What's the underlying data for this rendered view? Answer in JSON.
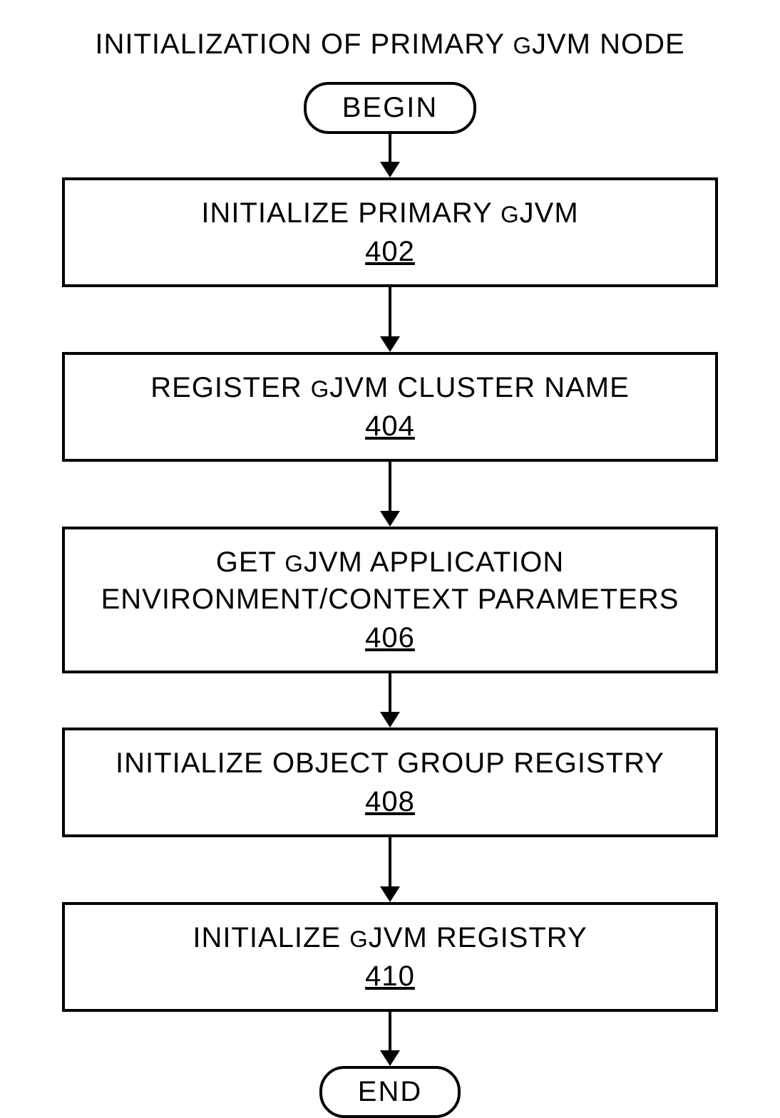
{
  "title_pre": "INITIALIZATION OF PRIMARY ",
  "title_g": "G",
  "title_post": "JVM NODE",
  "begin": "BEGIN",
  "end": "END",
  "steps": [
    {
      "text_pre": "INITIALIZE PRIMARY ",
      "text_g": "G",
      "text_post": "JVM",
      "line2": "",
      "ref": "402"
    },
    {
      "text_pre": "REGISTER ",
      "text_g": "G",
      "text_post": "JVM CLUSTER NAME",
      "line2": "",
      "ref": "404"
    },
    {
      "text_pre": "GET ",
      "text_g": "G",
      "text_post": "JVM APPLICATION",
      "line2": "ENVIRONMENT/CONTEXT PARAMETERS",
      "ref": "406"
    },
    {
      "text_pre": "INITIALIZE OBJECT GROUP REGISTRY",
      "text_g": "",
      "text_post": "",
      "line2": "",
      "ref": "408"
    },
    {
      "text_pre": "INITIALIZE ",
      "text_g": "G",
      "text_post": "JVM REGISTRY",
      "line2": "",
      "ref": "410"
    }
  ]
}
